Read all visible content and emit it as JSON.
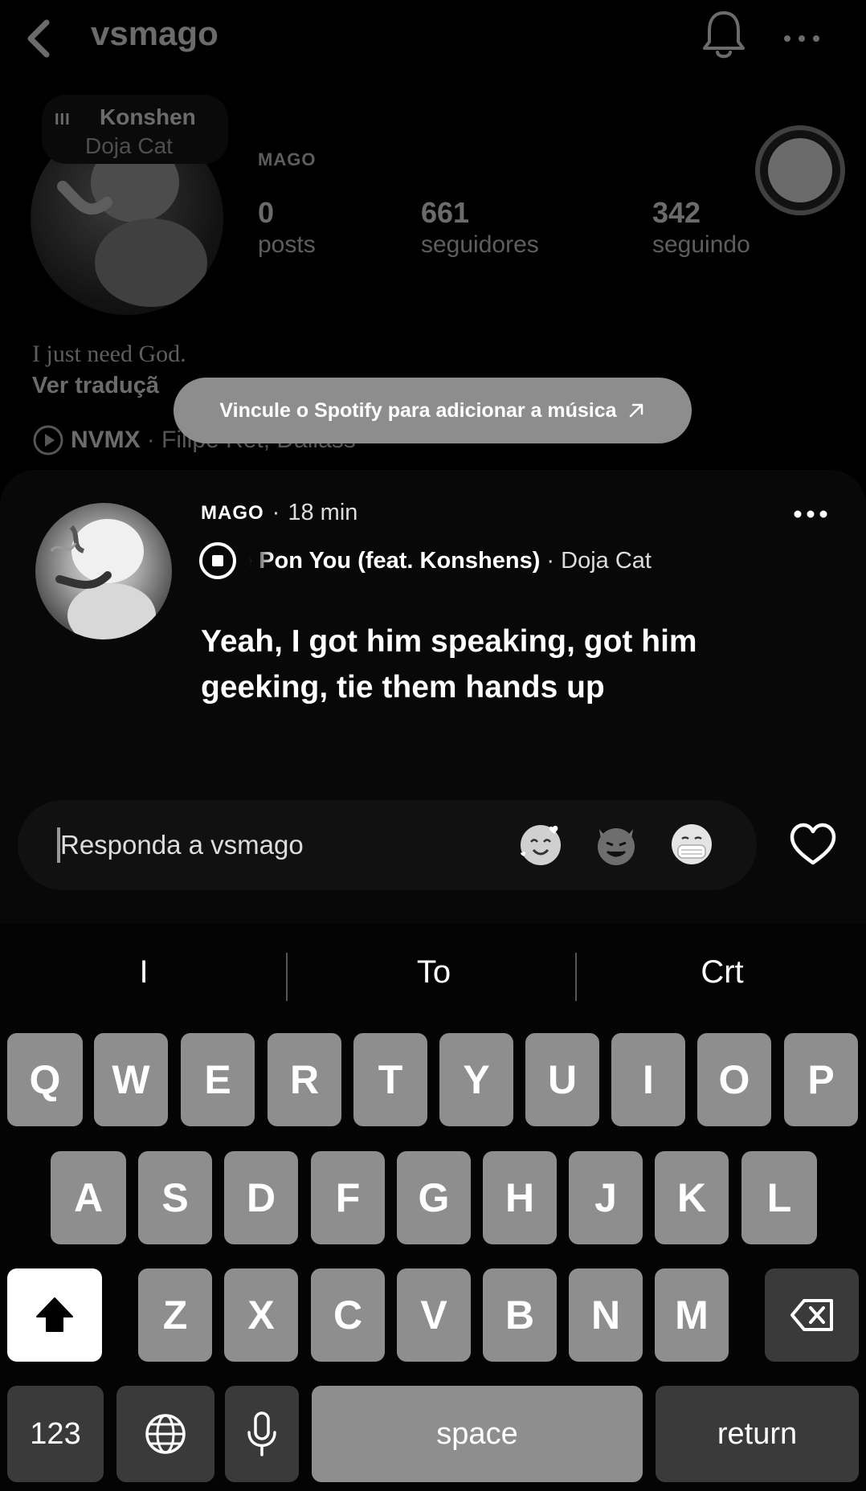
{
  "header": {
    "username": "vsmago",
    "back_icon": "chevron-left-icon",
    "bell_icon": "bell-icon",
    "more_icon": "more-horizontal-icon"
  },
  "note": {
    "bars": "III",
    "song": "Konshen",
    "artist": "Doja Cat"
  },
  "profile": {
    "display_name": "MAGO",
    "stats": [
      {
        "value": "0",
        "label": "posts"
      },
      {
        "value": "661",
        "label": "seguidores"
      },
      {
        "value": "342",
        "label": "seguindo"
      }
    ],
    "bio": "I just need God.",
    "translate": "Ver traduçã",
    "music_name": "NVMX",
    "music_artist": "· Filipe Ret, Dallass"
  },
  "spotify_prompt": "Vincule o Spotify para adicionar a música",
  "reply_sheet": {
    "name": "MAGO",
    "separator": "·",
    "time": "18 min",
    "song_title": "e Pon You (feat. Konshens)",
    "song_artist": "· Doja Cat",
    "lyrics": "Yeah, I got him speaking, got him geeking, tie them hands up"
  },
  "reply": {
    "placeholder": "Responda a vsmago",
    "emojis": [
      "smiling-face-with-hearts",
      "smiling-face-with-horns",
      "face-with-medical-mask"
    ]
  },
  "keyboard": {
    "suggestions": [
      "I",
      "To",
      "Crt"
    ],
    "row1": [
      "Q",
      "W",
      "E",
      "R",
      "T",
      "Y",
      "U",
      "I",
      "O",
      "P"
    ],
    "row2": [
      "A",
      "S",
      "D",
      "F",
      "G",
      "H",
      "J",
      "K",
      "L"
    ],
    "row3": [
      "Z",
      "X",
      "C",
      "V",
      "B",
      "N",
      "M"
    ],
    "numbers_label": "123",
    "space_label": "space",
    "return_label": "return"
  },
  "colors": {
    "background": "#000000",
    "key": "#8e8e8e",
    "key_dark": "#3a3a3a",
    "pill": "#8d8d8d"
  }
}
